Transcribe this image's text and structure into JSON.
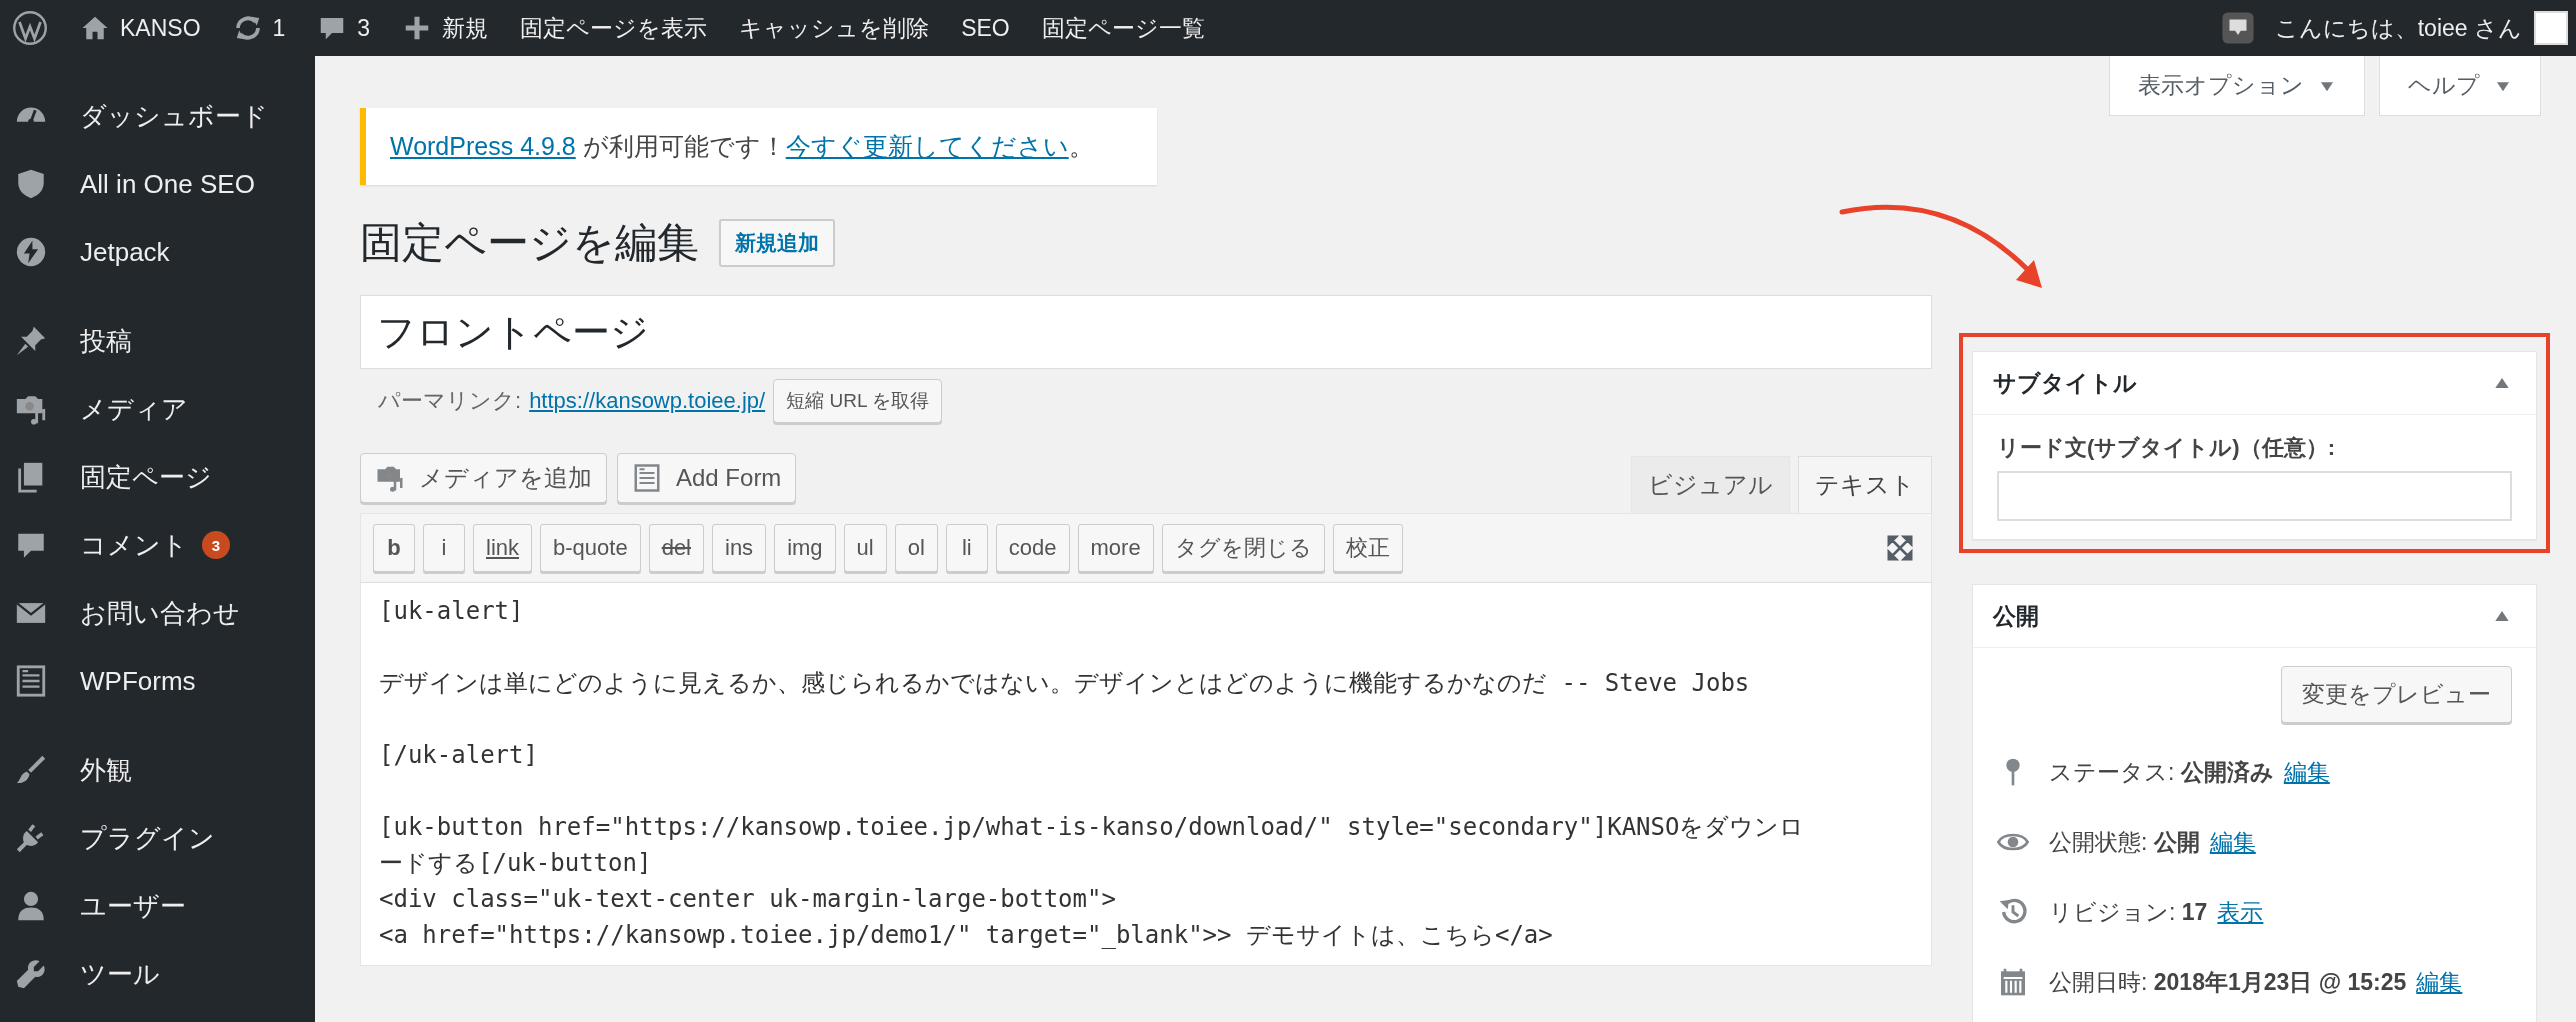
{
  "admin_bar": {
    "items": [
      {
        "kind": "logo"
      },
      {
        "kind": "site",
        "label": "KANSO"
      },
      {
        "kind": "updates",
        "label": "1"
      },
      {
        "kind": "comments",
        "label": "3"
      },
      {
        "kind": "new",
        "label": "新規"
      },
      {
        "kind": "link",
        "label": "固定ページを表示"
      },
      {
        "kind": "link",
        "label": "キャッシュを削除"
      },
      {
        "kind": "link",
        "label": "SEO"
      },
      {
        "kind": "link",
        "label": "固定ページ一覧"
      }
    ],
    "greeting": "こんにちは、toiee さん"
  },
  "sidebar": {
    "groups": [
      [
        {
          "label": "ダッシュボード"
        },
        {
          "label": "All in One SEO"
        },
        {
          "label": "Jetpack"
        }
      ],
      [
        {
          "label": "投稿"
        },
        {
          "label": "メディア"
        },
        {
          "label": "固定ページ"
        },
        {
          "label": "コメント",
          "badge": "3"
        },
        {
          "label": "お問い合わせ"
        },
        {
          "label": "WPForms"
        }
      ],
      [
        {
          "label": "外観"
        },
        {
          "label": "プラグイン"
        },
        {
          "label": "ユーザー"
        },
        {
          "label": "ツール"
        }
      ]
    ]
  },
  "screen_tabs": [
    {
      "label": "表示オプション"
    },
    {
      "label": "ヘルプ"
    }
  ],
  "notice": {
    "parts": [
      {
        "text": "WordPress 4.9.8",
        "link": true
      },
      {
        "text": " が利用可能です！",
        "link": false
      },
      {
        "text": "今すぐ更新してください",
        "link": true
      },
      {
        "text": "。",
        "link": false
      }
    ]
  },
  "page": {
    "heading": "固定ページを編集",
    "add_new": "新規追加",
    "title_value": "フロントページ",
    "permalink_label": "パーマリンク:",
    "permalink_url": "https://kansowp.toiee.jp/",
    "shortlink_button": "短縮 URL を取得"
  },
  "editor": {
    "media_buttons": [
      {
        "label": "メディアを追加"
      },
      {
        "label": "Add Form"
      }
    ],
    "tabs": [
      {
        "label": "ビジュアル",
        "selected": false
      },
      {
        "label": "テキスト",
        "selected": true
      }
    ],
    "quicktags": [
      {
        "label": "b"
      },
      {
        "label": "i"
      },
      {
        "label": "link"
      },
      {
        "label": "b-quote"
      },
      {
        "label": "del"
      },
      {
        "label": "ins"
      },
      {
        "label": "img"
      },
      {
        "label": "ul"
      },
      {
        "label": "ol"
      },
      {
        "label": "li"
      },
      {
        "label": "code"
      },
      {
        "label": "more"
      },
      {
        "label": "タグを閉じる"
      },
      {
        "label": "校正"
      }
    ],
    "paragraphs": [
      [
        "[uk-alert]"
      ],
      [
        "デザインは単にどのように見えるか、感じられるかではない。デザインとはどのように機能するかなのだ -- Steve Jobs"
      ],
      [
        "[/uk-alert]"
      ],
      [
        "[uk-button href=\"https://kansowp.toiee.jp/what-is-kanso/download/\" style=\"secondary\"]KANSOをダウンロ",
        "ードする[/uk-button]",
        "<div class=\"uk-text-center uk-margin-large-bottom\">",
        "<a href=\"https://kansowp.toiee.jp/demo1/\" target=\"_blank\">> デモサイトは、こちら</a>"
      ]
    ]
  },
  "side_boxes": [
    {
      "kind": "subtitle",
      "title": "サブタイトル",
      "highlighted": true,
      "field_label": "リード文(サブタイトル)（任意）:"
    },
    {
      "kind": "publish",
      "title": "公開",
      "highlighted": false,
      "preview_button": "変更をプレビュー",
      "rows": [
        {
          "label": "ステータス:",
          "value": "公開済み",
          "link": "編集"
        },
        {
          "label": "公開状態:",
          "value": "公開",
          "link": "編集"
        },
        {
          "label": "リビジョン:",
          "value": "17",
          "link": "表示"
        },
        {
          "label": "公開日時:",
          "value": "2018年1月23日 @ 15:25",
          "link": "編集"
        }
      ]
    }
  ]
}
